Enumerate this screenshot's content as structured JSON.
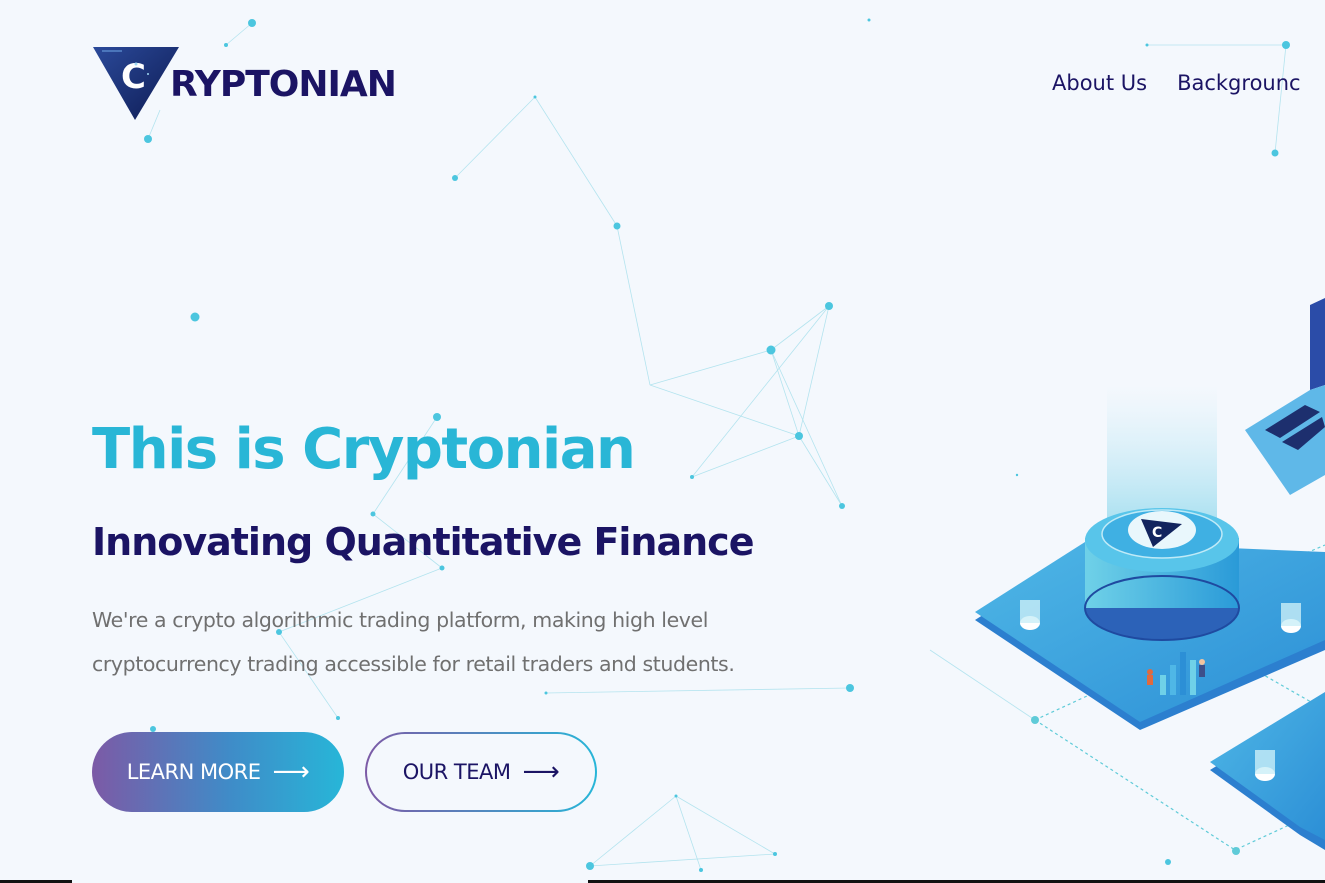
{
  "brand": {
    "name": "RYPTONIAN",
    "logo_letter": "C"
  },
  "nav": {
    "items": [
      {
        "label": "About Us"
      },
      {
        "label": "Backgrounc"
      }
    ]
  },
  "hero": {
    "title": "This is Cryptonian",
    "subtitle": "Innovating Quantitative Finance",
    "description_line1": "We're a crypto algorithmic trading platform, making high level",
    "description_line2": "cryptocurrency trading accessible for retail traders and students.",
    "primary_button": "LEARN MORE",
    "secondary_button": "OUR TEAM",
    "button_arrow_icon": "arrow-right-icon"
  },
  "colors": {
    "accent_cyan": "#29b6d6",
    "brand_navy": "#1b1464",
    "gradient_start": "#7c5aa6",
    "gradient_end": "#27b6d8",
    "background": "#f4f8fd",
    "body_text": "#707070"
  }
}
